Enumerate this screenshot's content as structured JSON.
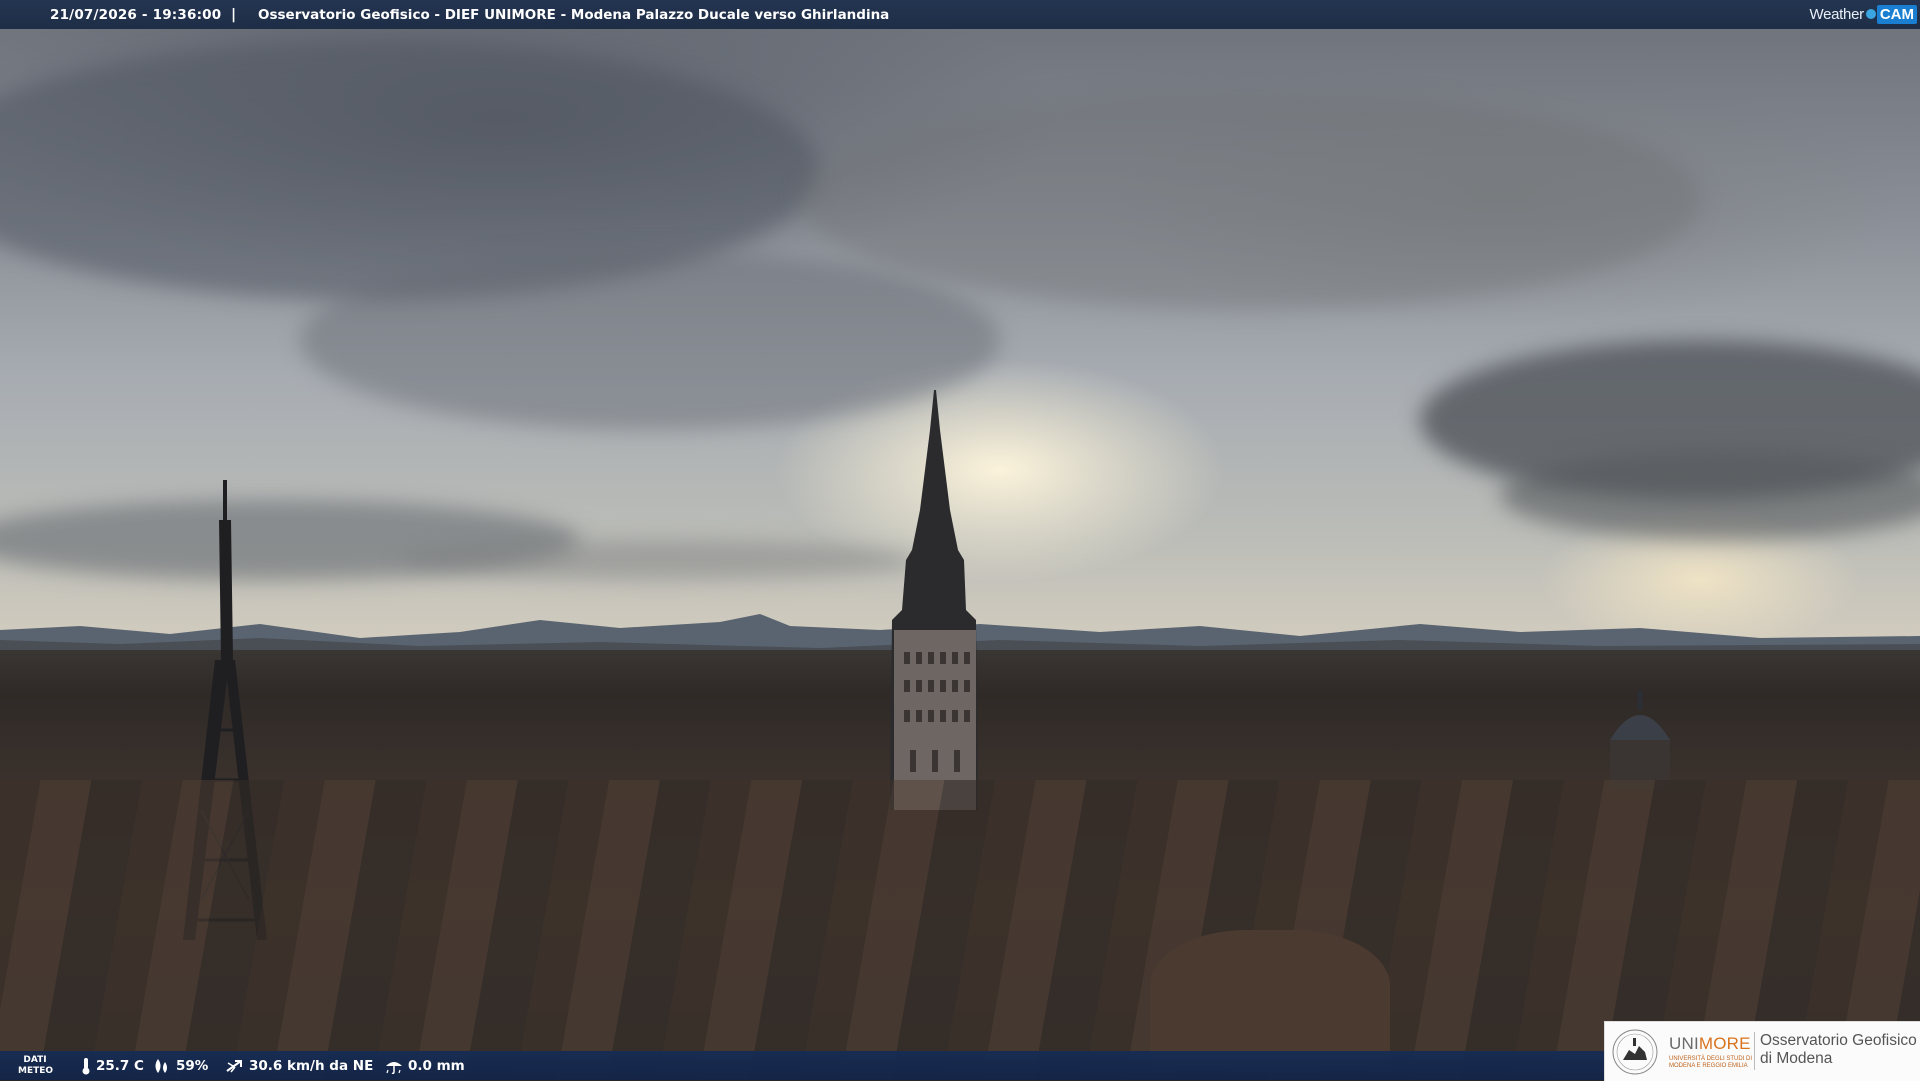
{
  "header": {
    "datetime": "21/07/2026 - 19:36:00",
    "separator": "|",
    "title": "Osservatorio Geofisico - DIEF UNIMORE - Modena Palazzo Ducale verso Ghirlandina"
  },
  "brand": {
    "weather_label": "Weather",
    "cam_label": "CAM",
    "accent_color": "#1a7fd0"
  },
  "weather_data": {
    "label_line1": "DATI",
    "label_line2": "METEO",
    "temperature": "25.7 C",
    "humidity": "59%",
    "wind": "30.6 km/h da NE",
    "rain": "0.0 mm",
    "icons": [
      "thermometer-icon",
      "humidity-icon",
      "wind-icon",
      "rain-gauge-icon"
    ]
  },
  "logo": {
    "uni_part1": "UNI",
    "uni_part2": "MORE",
    "uni_subtitle": "UNIVERSITÀ DEGLI STUDI DI MODENA E REGGIO EMILIA",
    "observatory_line1": "Osservatorio Geofisico",
    "observatory_line2": "di Modena"
  }
}
